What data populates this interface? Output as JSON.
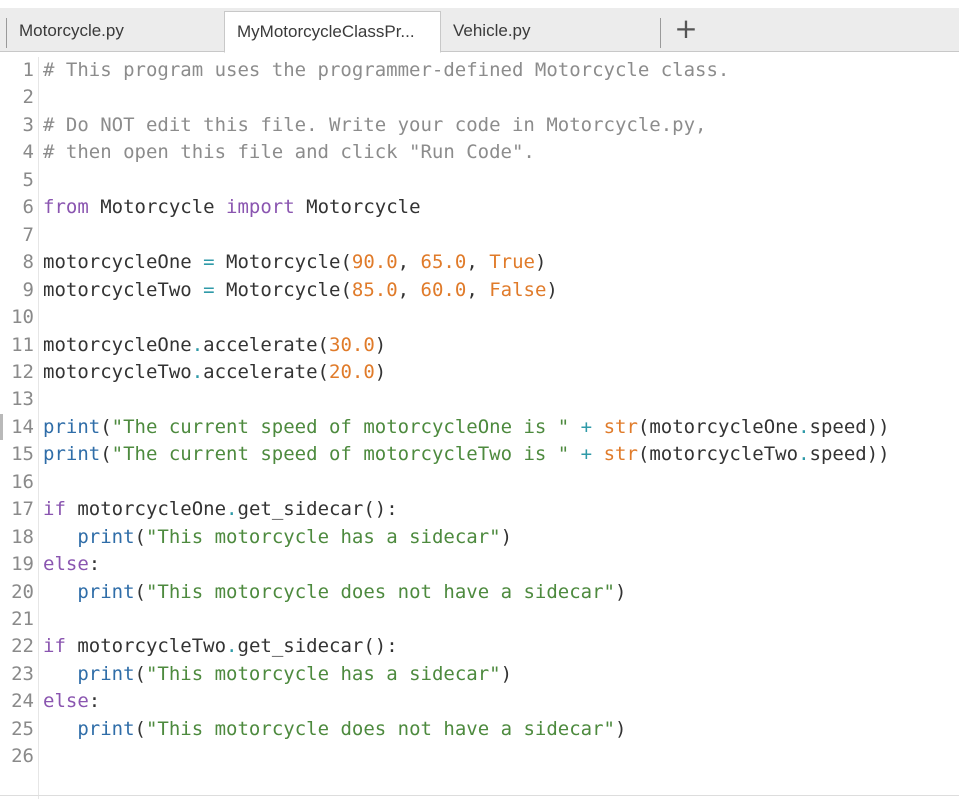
{
  "tabs": [
    {
      "label": "Motorcycle.py",
      "active": false
    },
    {
      "label": "MyMotorcycleClassPr...",
      "active": true
    },
    {
      "label": "Vehicle.py",
      "active": false
    }
  ],
  "add_tab_label": "+",
  "colors": {
    "comment": "#8c8c8c",
    "keyword": "#8a55b0",
    "function": "#2f6da8",
    "string": "#4d8a3e",
    "number": "#e07b2a",
    "line_number": "#8a8a8a"
  },
  "editor": {
    "language": "python",
    "lines": [
      "# This program uses the programmer-defined Motorcycle class.",
      "",
      "# Do NOT edit this file. Write your code in Motorcycle.py,",
      "# then open this file and click \"Run Code\".",
      "",
      "from Motorcycle import Motorcycle",
      "",
      "motorcycleOne = Motorcycle(90.0, 65.0, True)",
      "motorcycleTwo = Motorcycle(85.0, 60.0, False)",
      "",
      "motorcycleOne.accelerate(30.0)",
      "motorcycleTwo.accelerate(20.0)",
      "",
      "print(\"The current speed of motorcycleOne is \" + str(motorcycleOne.speed))",
      "print(\"The current speed of motorcycleTwo is \" + str(motorcycleTwo.speed))",
      "",
      "if motorcycleOne.get_sidecar():",
      "   print(\"This motorcycle has a sidecar\")",
      "else:",
      "   print(\"This motorcycle does not have a sidecar\")",
      "",
      "if motorcycleTwo.get_sidecar():",
      "   print(\"This motorcycle has a sidecar\")",
      "else:",
      "   print(\"This motorcycle does not have a sidecar\")",
      ""
    ]
  }
}
